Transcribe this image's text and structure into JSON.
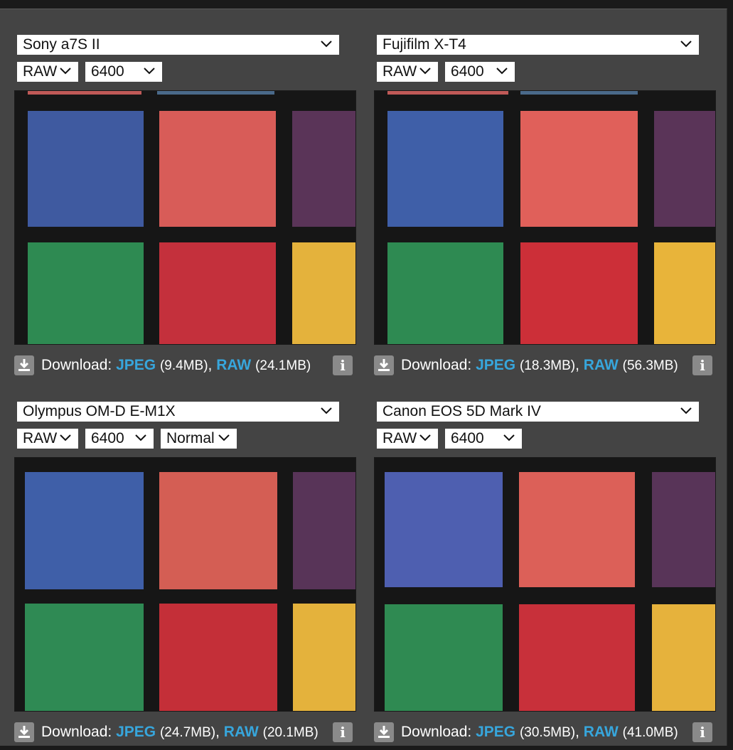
{
  "panels": [
    {
      "camera": "Sony a7S II",
      "format": "RAW",
      "iso": "6400",
      "download_label": "Download:",
      "jpeg_label": "JPEG",
      "jpeg_size": "(9.4MB)",
      "raw_label": "RAW",
      "raw_size": "(24.1MB)",
      "info_label": "i"
    },
    {
      "camera": "Fujifilm X-T4",
      "format": "RAW",
      "iso": "6400",
      "download_label": "Download:",
      "jpeg_label": "JPEG",
      "jpeg_size": "(18.3MB)",
      "raw_label": "RAW",
      "raw_size": "(56.3MB)",
      "info_label": "i"
    },
    {
      "camera": "Olympus OM-D E-M1X",
      "format": "RAW",
      "iso": "6400",
      "mode": "Normal",
      "download_label": "Download:",
      "jpeg_label": "JPEG",
      "jpeg_size": "(24.7MB)",
      "raw_label": "RAW",
      "raw_size": "(20.1MB)",
      "info_label": "i"
    },
    {
      "camera": "Canon EOS 5D Mark IV",
      "format": "RAW",
      "iso": "6400",
      "download_label": "Download:",
      "jpeg_label": "JPEG",
      "jpeg_size": "(30.5MB)",
      "raw_label": "RAW",
      "raw_size": "(41.0MB)",
      "info_label": "i"
    }
  ],
  "colors": {
    "background": "#444444",
    "link": "#37a6dc",
    "patch_blue": "#3f5aa0",
    "patch_salmon": "#d85c58",
    "patch_purple": "#5a3458",
    "patch_green": "#2e8a52",
    "patch_red": "#c4303c",
    "patch_yellow": "#e4b23c"
  }
}
